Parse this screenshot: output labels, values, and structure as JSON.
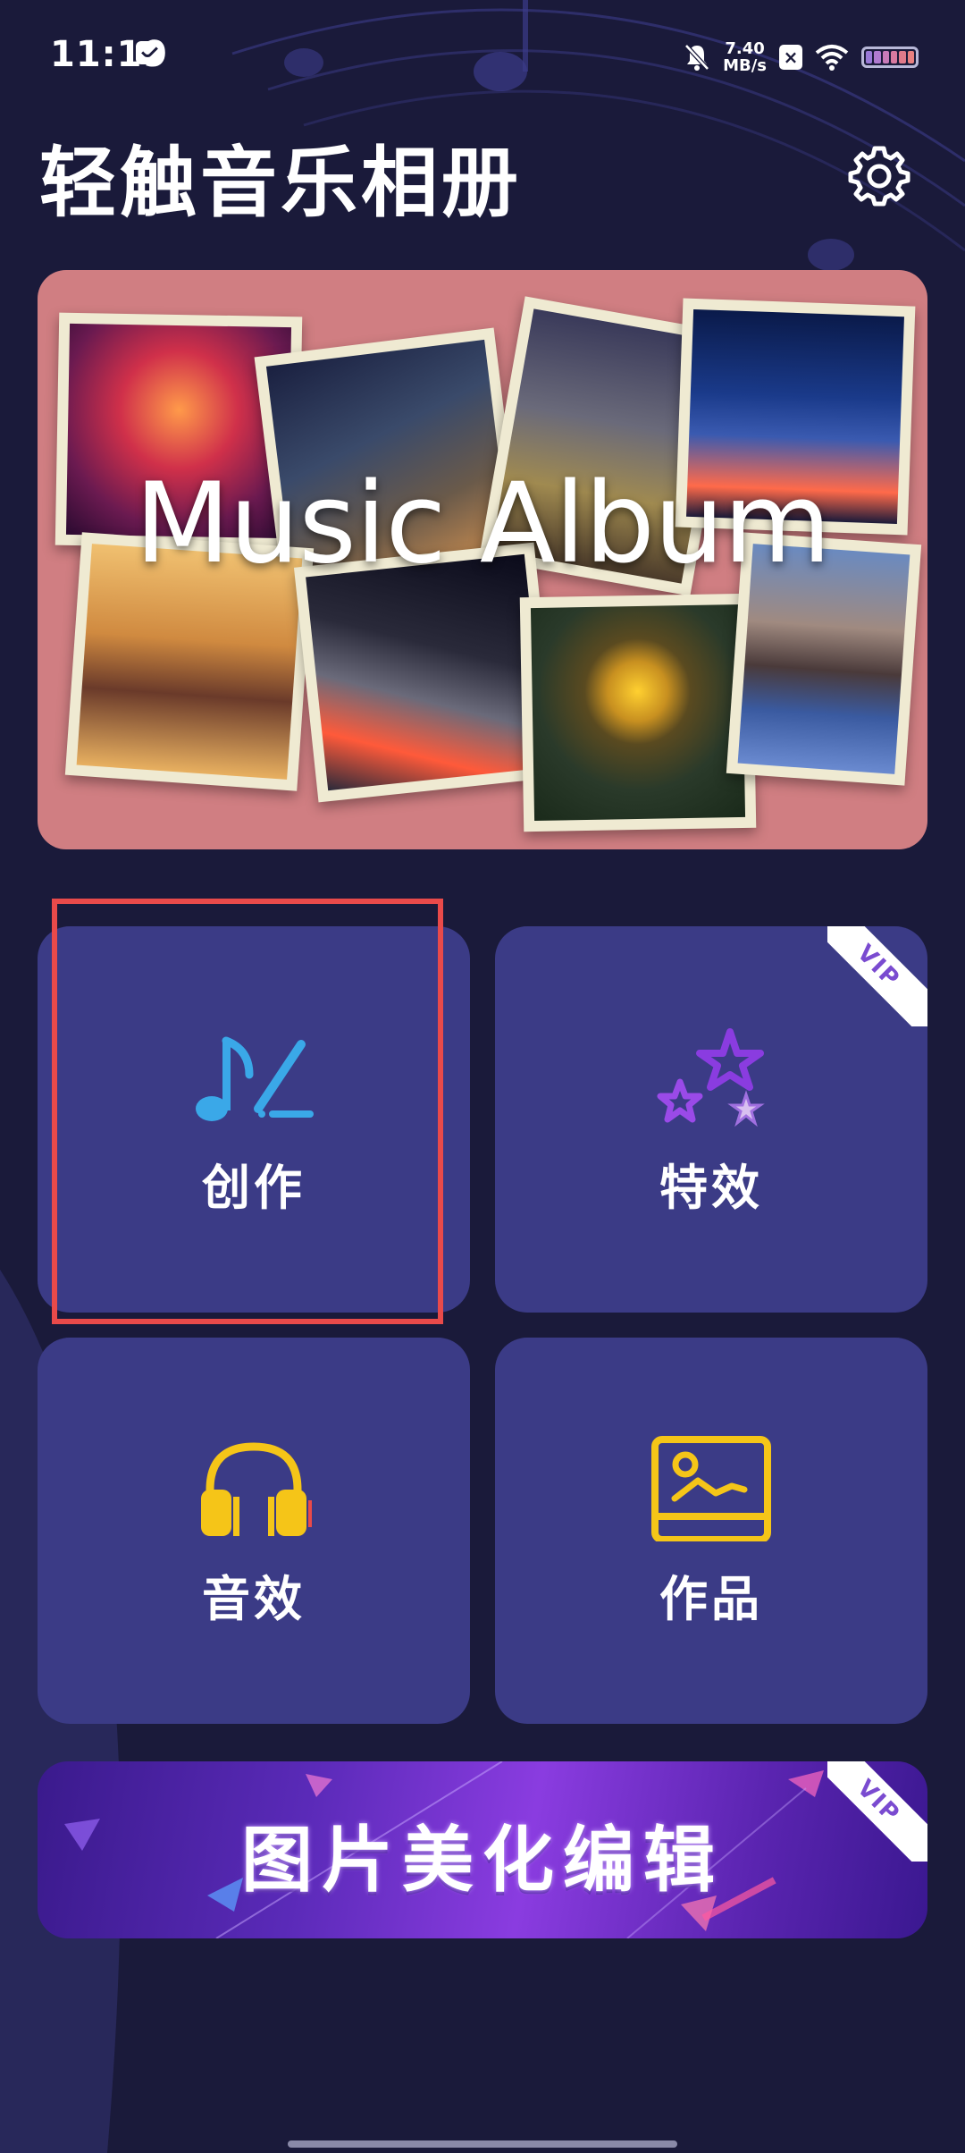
{
  "status_bar": {
    "time": "11:19",
    "net_speed_value": "7.40",
    "net_speed_unit": "MB/s",
    "icons": [
      "message-icon",
      "mute-bell-icon",
      "sim-x-icon",
      "wifi-icon",
      "battery-icon"
    ]
  },
  "header": {
    "title": "轻触音乐相册",
    "settings_icon": "gear-icon"
  },
  "hero_banner": {
    "title": "Music Album"
  },
  "features": [
    {
      "label": "创作",
      "icon": "music-note-pen-icon",
      "vip": false
    },
    {
      "label": "特效",
      "icon": "stars-icon",
      "vip": true
    },
    {
      "label": "音效",
      "icon": "headphones-icon",
      "vip": false
    },
    {
      "label": "作品",
      "icon": "gallery-icon",
      "vip": false
    }
  ],
  "vip_badge": "VIP",
  "bottom_banner": {
    "text": "图片美化编辑",
    "vip": true
  },
  "colors": {
    "background": "#1a1a3a",
    "card": "#3b3b86",
    "hero": "#d07e82",
    "highlight": "#e94a4a",
    "icon_blue": "#3aa8e8",
    "icon_purple": "#8a3ce0",
    "icon_yellow": "#f5c518"
  }
}
